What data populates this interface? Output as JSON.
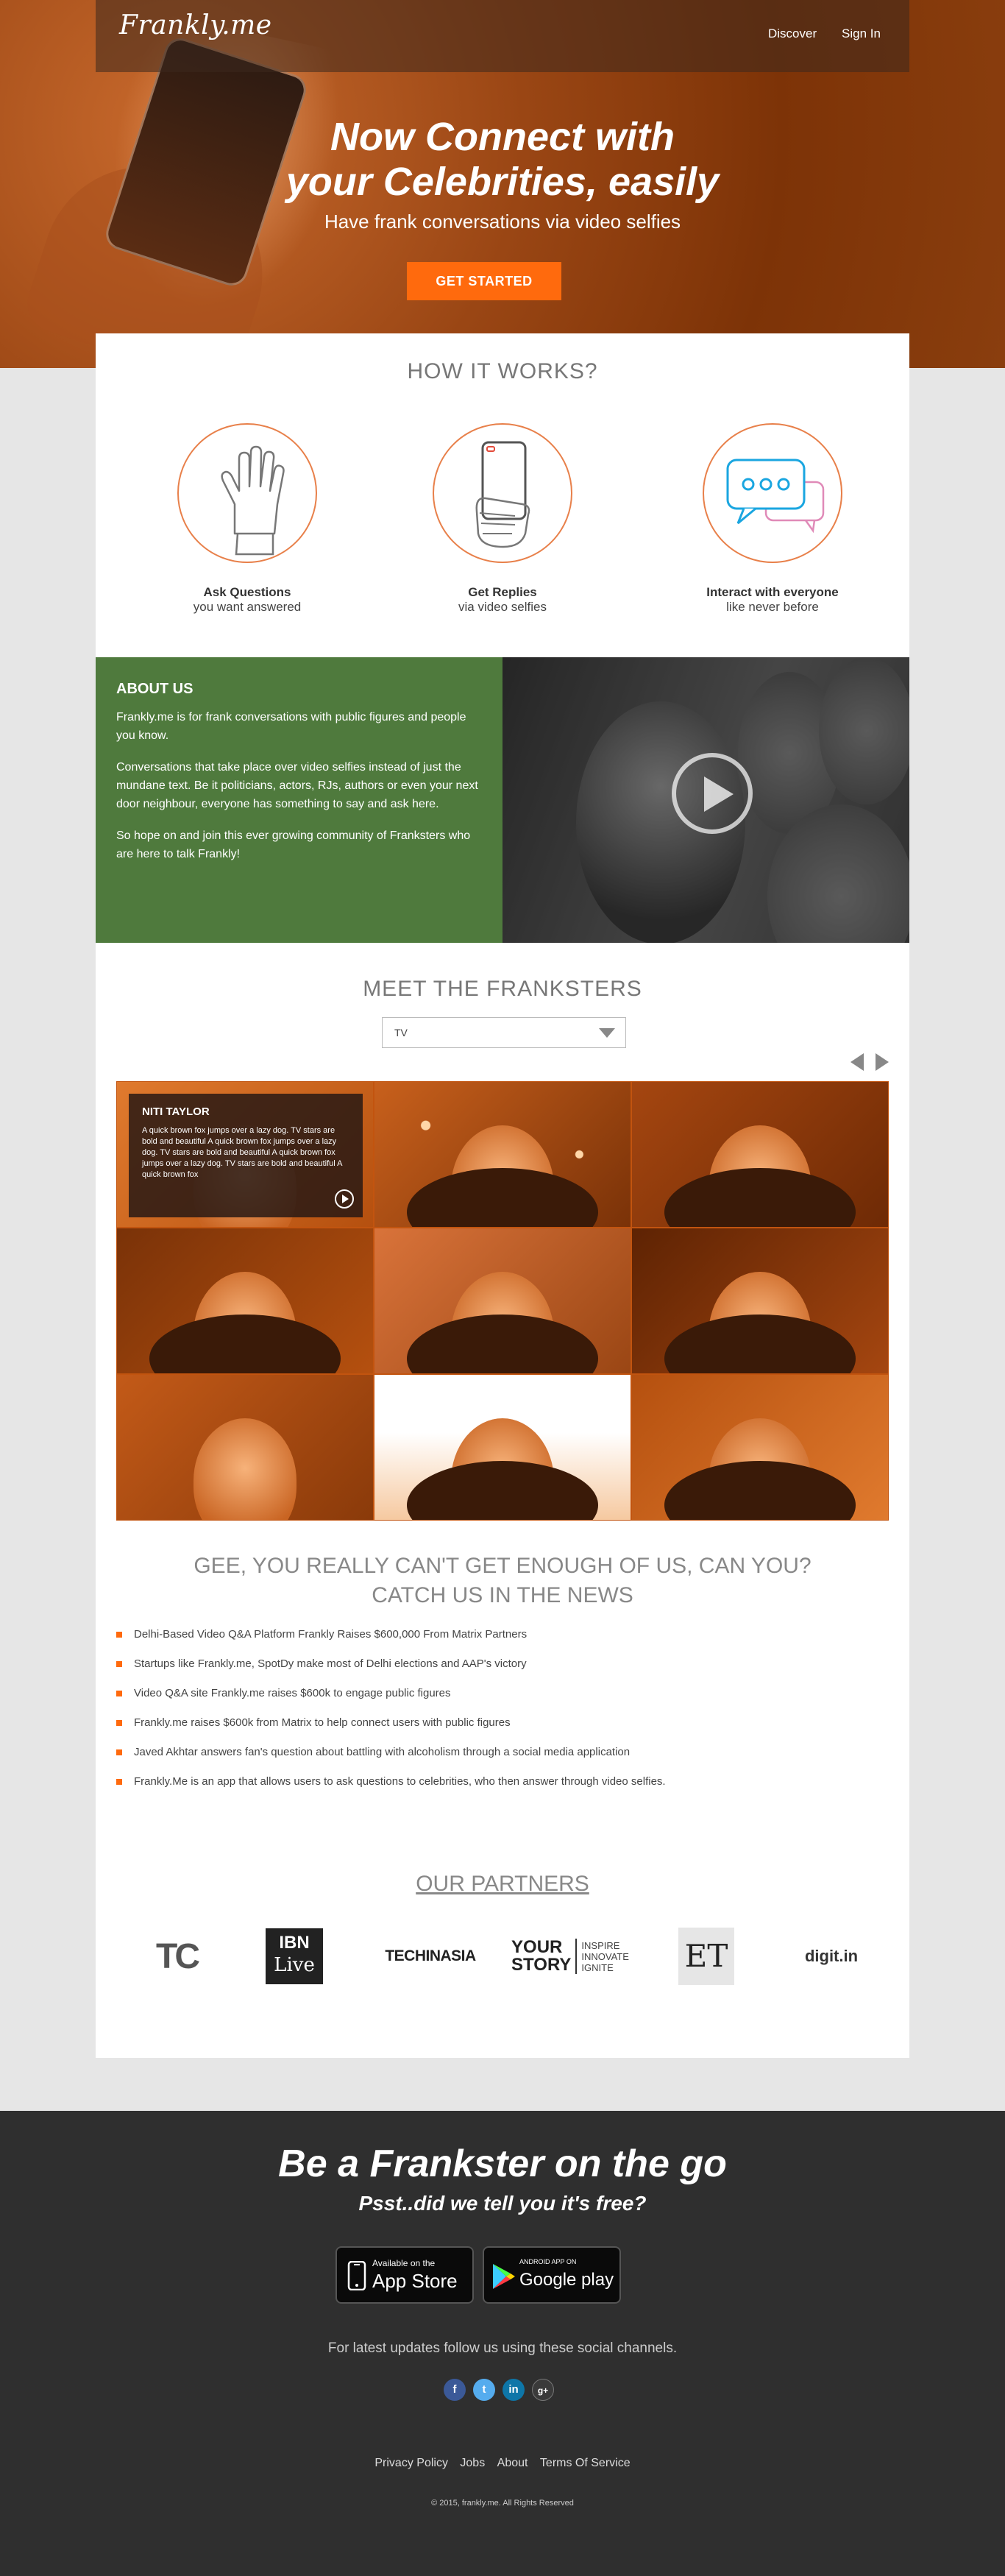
{
  "header": {
    "logo": "Frankly.me",
    "nav": [
      "Discover",
      "Sign In"
    ]
  },
  "hero": {
    "title_line1": "Now Connect with",
    "title_line2": "your Celebrities, easily",
    "subtitle": "Have frank conversations via video selfies",
    "cta": "GET STARTED"
  },
  "how": {
    "title": "HOW IT WORKS?",
    "items": [
      {
        "title": "Ask Questions",
        "sub": "you want answered",
        "icon": "hand-icon"
      },
      {
        "title": "Get Replies",
        "sub": "via video selfies",
        "icon": "phone-selfie-icon"
      },
      {
        "title": "Interact with everyone",
        "sub": "like never before",
        "icon": "chat-bubbles-icon"
      }
    ]
  },
  "about": {
    "title": "ABOUT US",
    "p1": "Frankly.me is for frank conversations with public figures and people you know.",
    "p2": "Conversations that take place over video selfies instead of just the mundane text. Be it politicians, actors, RJs, authors or even your next door neighbour, everyone has something to say and ask here.",
    "p3": "So hope on and join this ever growing community of Franksters who are here to talk Frankly!"
  },
  "franksters": {
    "title": "MEET THE FRANKSTERS",
    "category": "TV",
    "featured": {
      "name": "NITI TAYLOR",
      "bio": "A quick brown fox jumps over a lazy dog. TV stars are bold and beautiful A quick brown fox jumps over a lazy dog. TV stars are bold and beautiful A quick brown fox jumps over a lazy dog. TV stars are bold and beautiful A quick brown fox"
    }
  },
  "news": {
    "title_line1": "GEE, YOU REALLY CAN'T GET ENOUGH OF US, CAN YOU?",
    "title_line2": "CATCH US IN THE NEWS",
    "items": [
      "Delhi-Based Video Q&A Platform Frankly Raises $600,000 From Matrix Partners",
      "Startups like Frankly.me, SpotDy make most of Delhi elections and AAP's victory",
      "Video Q&A site Frankly.me raises $600k to engage public figures",
      "Frankly.me raises $600k from Matrix to help connect users with public figures",
      "Javed Akhtar answers fan's question about battling with alcoholism through a social media application",
      "Frankly.Me is an app that allows users to ask questions to celebrities, who then answer through video selfies."
    ]
  },
  "partners": {
    "title": "OUR PARTNERS",
    "logos": {
      "tc": "TC",
      "ibn_top": "IBN",
      "ibn_bottom": "Live",
      "techinasia": "TECHINASIA",
      "ys_left1": "YOUR",
      "ys_left2": "STORY",
      "ys_right1": "INSPIRE",
      "ys_right2": "INNOVATE",
      "ys_right3": "IGNITE",
      "et": "ET",
      "digit": "digit.in"
    }
  },
  "footer": {
    "title": "Be a Frankster on the go",
    "subtitle": "Psst..did we tell you it's free?",
    "appstore_small": "Available on the",
    "appstore_big": "App Store",
    "gplay_small": "ANDROID APP ON",
    "gplay_big": "Google play",
    "follow": "For latest updates follow us using these social channels.",
    "links": [
      "Privacy Policy",
      "Jobs",
      "About",
      "Terms Of Service"
    ],
    "copyright": "© 2015, frankly.me. All Rights Reserved"
  },
  "colors": {
    "accent": "#ff6a0d",
    "about_bg": "#4f7a3d",
    "footer_bg": "#2f2f2f"
  }
}
